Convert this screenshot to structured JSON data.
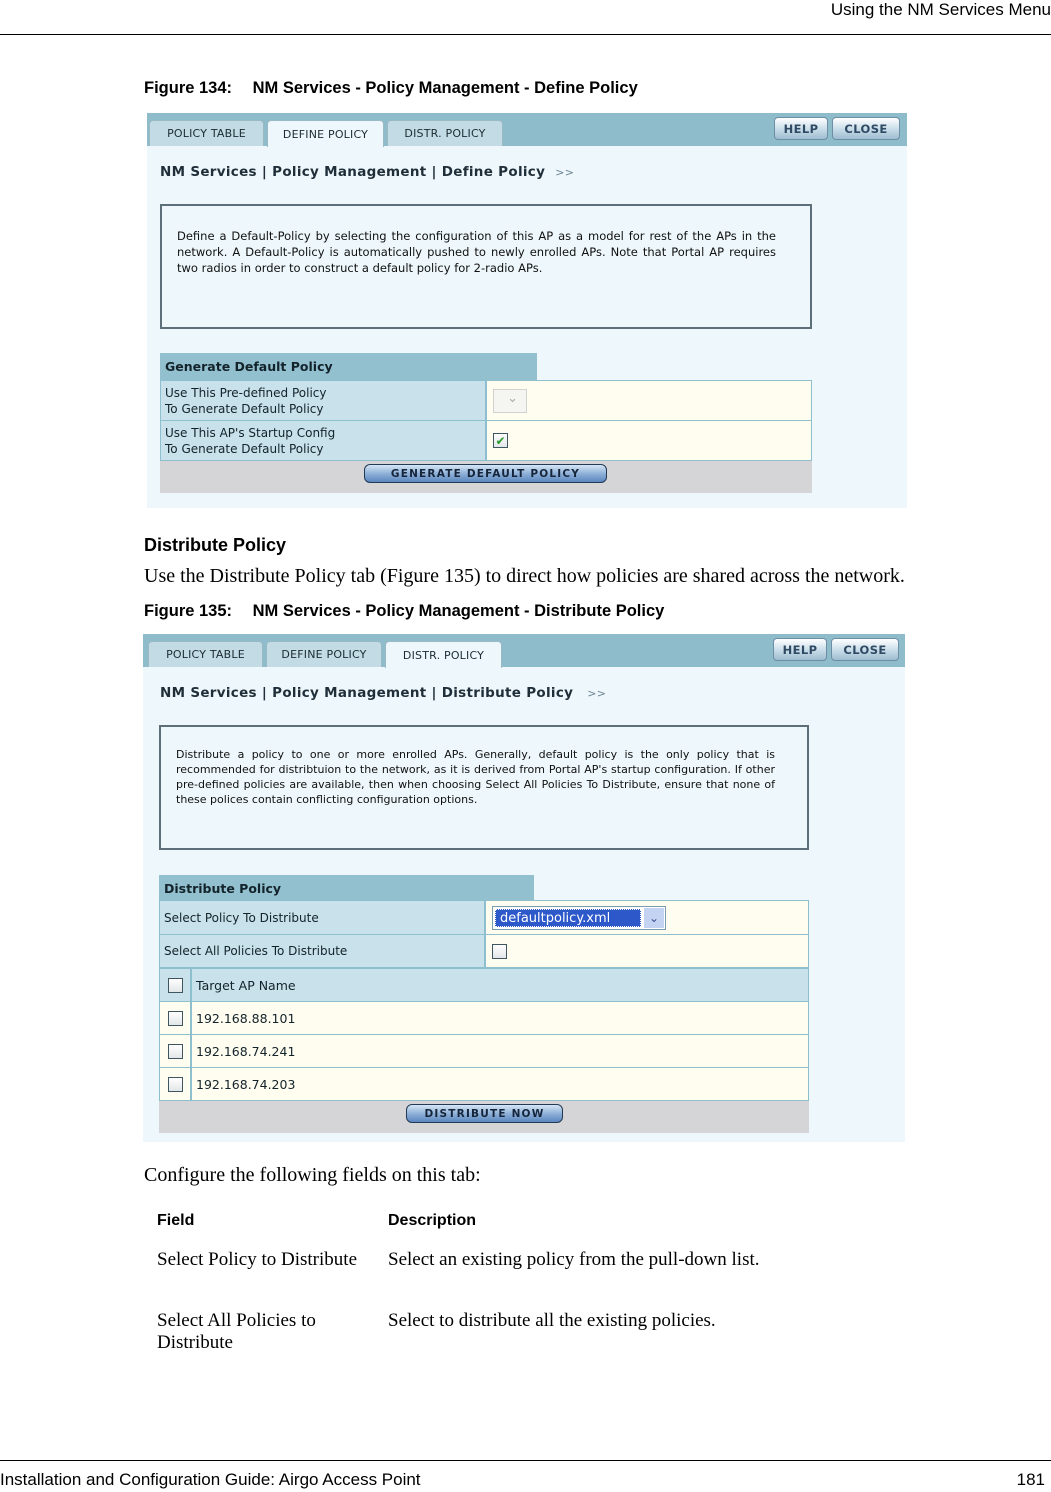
{
  "page": {
    "running_header": "Using the NM Services Menu",
    "footer_title": "Installation and Configuration Guide: Airgo Access Point",
    "page_number": "181"
  },
  "figure134": {
    "caption_num": "Figure 134:",
    "caption_text": "NM Services - Policy Management - Define Policy",
    "tabs": [
      "POLICY TABLE",
      "DEFINE POLICY",
      "DISTR. POLICY"
    ],
    "active_tab": "DEFINE POLICY",
    "help_label": "HELP",
    "close_label": "CLOSE",
    "breadcrumb": "NM Services | Policy Management | Define Policy",
    "breadcrumb_arrows": ">>",
    "info": "Define a Default-Policy by selecting the configuration of this AP as a model for rest of the APs in the network. A Default-Policy is automatically pushed to newly enrolled APs. Note that Portal AP requires two radios in order to construct a default policy for 2-radio APs.",
    "section_title": "Generate Default Policy",
    "fields": [
      {
        "label_line1": "Use This Pre-defined Policy",
        "label_line2": "To Generate Default Policy",
        "control": "select",
        "value": "",
        "enabled": false
      },
      {
        "label_line1": "Use This AP's Startup Config",
        "label_line2": "To Generate Default Policy",
        "control": "checkbox",
        "checked": true
      }
    ],
    "checkmark": "✔",
    "button_label": "GENERATE DEFAULT POLICY"
  },
  "section": {
    "heading": "Distribute Policy",
    "intro": "Use the Distribute Policy tab (Figure 135) to direct how policies are shared across the network."
  },
  "figure135": {
    "caption_num": "Figure 135:",
    "caption_text": "NM Services - Policy Management - Distribute Policy",
    "tabs": [
      "POLICY TABLE",
      "DEFINE POLICY",
      "DISTR. POLICY"
    ],
    "active_tab": "DISTR. POLICY",
    "help_label": "HELP",
    "close_label": "CLOSE",
    "breadcrumb": "NM Services | Policy Management | Distribute Policy",
    "breadcrumb_arrows": ">>",
    "info": "Distribute a policy to one or more enrolled APs. Generally, default policy is the only policy that is recommended for distribtuion to the network, as it is derived from Portal AP's startup configuration. If other pre-defined policies are available, then when choosing Select All Policies To Distribute, ensure that none of these polices contain conflicting configuration options.",
    "section_title": "Distribute Policy",
    "select_policy_label": "Select Policy To Distribute",
    "select_policy_value": "defaultpolicy.xml",
    "select_all_label": "Select All Policies To Distribute",
    "select_all_checked": false,
    "target_header": "Target AP Name",
    "targets": [
      {
        "name": "192.168.88.101",
        "checked": false
      },
      {
        "name": "192.168.74.241",
        "checked": false
      },
      {
        "name": "192.168.74.203",
        "checked": false
      }
    ],
    "button_label": "DISTRIBUTE NOW"
  },
  "configure_text": "Configure the following fields on this tab:",
  "field_table": {
    "headers": [
      "Field",
      "Description"
    ],
    "rows": [
      {
        "field": "Select Policy to Distribute",
        "description": "Select an existing policy from the pull-down list."
      },
      {
        "field": "Select All Policies to Distribute",
        "description": "Select to distribute all the existing policies."
      }
    ]
  }
}
